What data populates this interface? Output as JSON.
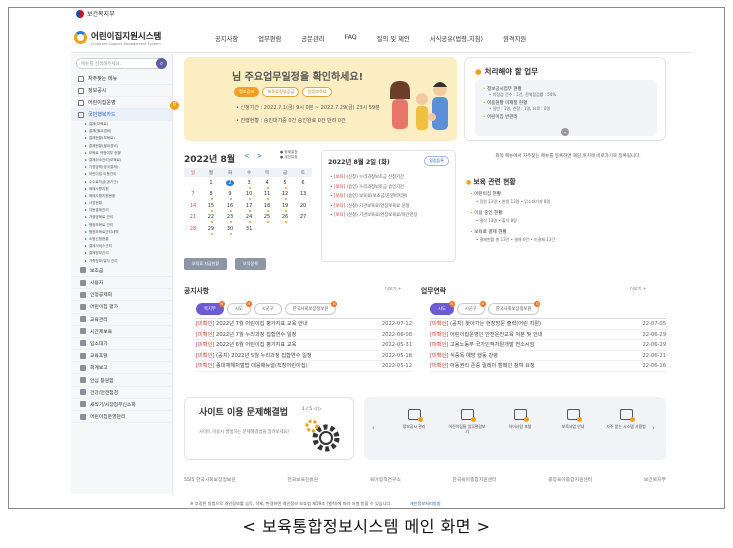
{
  "header": {
    "ministry": "보건복지부",
    "logo_title": "어린이집지원시스템",
    "logo_sub": "Childcare Support Management System",
    "gnb": [
      "공지사항",
      "업무편람",
      "공문관리",
      "FAQ",
      "질의 및 제안",
      "서식공유(법령,지침)",
      "원격지원"
    ]
  },
  "sidebar": {
    "search_placeholder": "메뉴를 검색해주세요.",
    "badge": "0",
    "items": [
      {
        "label": "자주찾는 메뉴",
        "active": false
      },
      {
        "label": "정보공시",
        "active": false
      },
      {
        "label": "어린이집운영",
        "active": false
      },
      {
        "label": "국민행복카드",
        "active": true
      }
    ],
    "subitems": [
      "결제(보육료)",
      "결제(필요경비)",
      "결제현황(보육료)",
      "결제현황(필요경비)",
      "보육료 적정여부 현황",
      "결제취소관리(보육료)",
      "가정양육(공국결제)",
      "어린이집 이용관리",
      "수수료지급(공기관)",
      "매매사항지원",
      "매매사항지원현황",
      "사업현황",
      "자동결제관리",
      "가정양육료 관리",
      "행정보육료 관리",
      "행정보육료관리내역",
      "소명신청현황",
      "결제서비스관리",
      "결제정보관리",
      "가족정보/일자 관리"
    ],
    "items2": [
      "보조금",
      "사용자",
      "인정공제회",
      "어린이집 평가",
      "교육관리",
      "시간제보육",
      "입소대기",
      "교육포털",
      "회계보고",
      "안심 등원함",
      "건강/안전점검",
      "새싹기/시장업무신소화",
      "어린이집운영관리"
    ]
  },
  "banner": {
    "title": "님 주요업무일정을 확인하세요!",
    "pills": [
      "정보감시",
      "보육료정보공금",
      "인정보육료"
    ],
    "line1": "• 신청기간 : 2022.7.1(금) 9시 0분 ~ 2022.7.29(금) 23시 59분",
    "line2": "• 진행현황 : 승인대기중 0건 승인완료 0건 반려 0건"
  },
  "todo": {
    "title": "처리해야 할 업무",
    "items": [
      {
        "k": "정보공시업무 현황",
        "v": "• 미점검 건수 : 1건, 전체점검률 : 54%"
      },
      {
        "k": "이용현황 미제정 현황",
        "v": "• 일반 : 1명, 연장 : 1명, 요육 : 0명"
      },
      {
        "k": "어린이집 반관리",
        "v": ""
      }
    ]
  },
  "calendar": {
    "month": "2022년 8월",
    "legend": [
      "● 정례일정",
      "● 개인일정"
    ],
    "weekdays": [
      "일",
      "월",
      "화",
      "수",
      "목",
      "금",
      "토"
    ],
    "weeks": [
      [
        "",
        "1",
        "2",
        "3",
        "4",
        "5",
        "6"
      ],
      [
        "7",
        "8",
        "9",
        "10",
        "11",
        "12",
        "13"
      ],
      [
        "14",
        "15",
        "16",
        "17",
        "18",
        "19",
        "20"
      ],
      [
        "21",
        "22",
        "23",
        "24",
        "25",
        "26",
        "27"
      ],
      [
        "28",
        "29",
        "30",
        "31",
        "",
        "",
        ""
      ]
    ],
    "today": "2",
    "btn_left": "보육료 지급현황",
    "btn_right": "보육정책"
  },
  "day": {
    "date": "2022년 8월 2일 (화)",
    "btn": "일정등록",
    "items": [
      {
        "tag": "[보육]",
        "text": "(신청) 누리과정보조금 신청기간"
      },
      {
        "tag": "[보육]",
        "text": "(승인) 누리과정보조금 승인기간"
      },
      {
        "tag": "[보육]",
        "text": "(승인) 보육료(보조금/운영비지원)"
      },
      {
        "tag": "[보육]",
        "text": "(신청) 기관보육료/연장보육료 신청"
      },
      {
        "tag": "[보육]",
        "text": "(신청) 기관보육료/연장보육료/야간연장"
      }
    ]
  },
  "notice_right": "외쪽 메뉴에서 자주찾는 메뉴를 등록하면 해당 위치에 바로가기로 등록됩니다.",
  "status": {
    "title": "보육 관련 현황",
    "items": [
      {
        "k": "어린이집 현황",
        "v": "• 정원 13명 • 현원 13명 • 입소대기자 8명"
      },
      {
        "k": "이용 중인 현황",
        "v": "• 결식 13명 • 출석 8명"
      },
      {
        "k": "보육료 결제 현황",
        "v": "• 결제현황 총 13건 • 결제 6건 • 미결제 13건"
      }
    ]
  },
  "notices": {
    "title": "공지사항",
    "more": "더보기 +",
    "tabs": [
      {
        "label": "복지부",
        "n": "N",
        "on": true
      },
      {
        "label": "시도",
        "n": "N",
        "on": false
      },
      {
        "label": "시군구",
        "n": "",
        "on": false
      },
      {
        "label": "한국사회보장정보원",
        "n": "N",
        "on": false
      }
    ],
    "rows": [
      {
        "tag": "[미확인]",
        "text": "2022년 7월 어린이집 평가지표 교육 안내",
        "date": "2022-07-12"
      },
      {
        "tag": "[미확인]",
        "text": "2022년 7월 누리과정 집합연수 일정",
        "date": "2022-06-08"
      },
      {
        "tag": "[미확인]",
        "text": "2022년 6월 어린이집 평가지표 교육",
        "date": "2022-05-31"
      },
      {
        "tag": "[미확인]",
        "text": "(공지) 2022년 5월 누리과정 집합연수 일정",
        "date": "2022-05-18"
      },
      {
        "tag": "[미확인]",
        "text": "종대재해처벌법 대응매뉴얼(직장어린이집)",
        "date": "2022-05-12"
      }
    ]
  },
  "work": {
    "title": "업무연락",
    "more": "더보기 +",
    "tabs": [
      {
        "label": "시도",
        "n": "N",
        "on": true
      },
      {
        "label": "시군구",
        "n": "N",
        "on": false
      },
      {
        "label": "한국사회보장정보원",
        "n": "N",
        "on": false
      }
    ],
    "rows": [
      {
        "tag": "[미확인]",
        "text": "(공지) 찾아가는 현장방문 출력(어린 지원)",
        "date": "22-07-05"
      },
      {
        "tag": "[미확인]",
        "text": "어린이집운영인 안전운전교육 처분 및 안내",
        "date": "22-06-29"
      },
      {
        "tag": "[미확인]",
        "text": "고용노동부 국가인적자원개발 컨소시엄",
        "date": "22-06-29"
      },
      {
        "tag": "[미확인]",
        "text": "식중독 예방 행동 강령",
        "date": "22-06-21"
      },
      {
        "tag": "[미확인]",
        "text": "아동권리 존중 릴레이 캠페인 참여 요청",
        "date": "22-06-16"
      }
    ]
  },
  "faq": {
    "title": "사이트 이용 문제해결법",
    "sub": "사이트 이용시 발생하는 문제해결법을 알려보세요!",
    "page": "1 / 5 ◁ ▷"
  },
  "quick": {
    "items": [
      "정보공시 관리",
      "어린이집들 업무편람보기",
      "아이사랑 포털",
      "보육사업 안내",
      "자주 묻는 시스템 사용법"
    ]
  },
  "logos": [
    "SSiS 한국사회보장정보원",
    "한국보육진흥원",
    "육아정책연구소",
    "한국육아종합지원센터",
    "중앙육아종합지원센터",
    "보건복지부"
  ],
  "footer": {
    "text": "※ 부정한 방법으로 개인정보를 습득, 삭제, 변경하면 개인정보 보호법 제59조 (벌칙)에 따라 처벌 받을 수 있습니다.",
    "link": "개인정보처리방침"
  },
  "caption": "< 보육통합정보시스템 메인 화면 >",
  "colors": {
    "accent": "#2a7bd8",
    "banner": "#fbeec2",
    "orange": "#f0a020",
    "tab_on": "#6c5bd4"
  }
}
